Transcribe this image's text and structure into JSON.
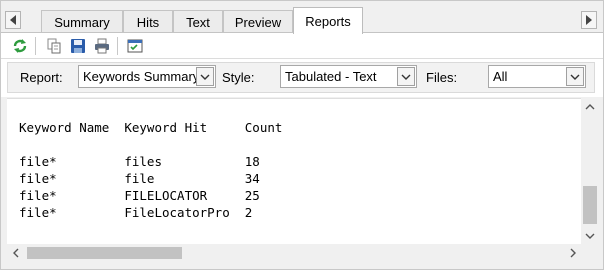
{
  "tabs": [
    {
      "label": "Summary"
    },
    {
      "label": "Hits"
    },
    {
      "label": "Text"
    },
    {
      "label": "Preview"
    },
    {
      "label": "Reports",
      "active": true
    }
  ],
  "toolbar": {
    "icons": [
      "refresh-icon",
      "copy-icon",
      "save-icon",
      "print-icon",
      "select-all-icon"
    ]
  },
  "options": {
    "report_label": "Report:",
    "report_value": "Keywords Summary",
    "style_label": "Style:",
    "style_value": "Tabulated - Text",
    "files_label": "Files:",
    "files_value": "All"
  },
  "report": {
    "text": "Keyword Name  Keyword Hit     Count\n\nfile*         files           18\nfile*         file            34\nfile*         FILELOCATOR     25\nfile*         FileLocatorPro  2"
  },
  "colors": {
    "accent_green": "#2e9b3e",
    "save_blue": "#2a5caa",
    "frame_gray": "#f0f0f0"
  }
}
